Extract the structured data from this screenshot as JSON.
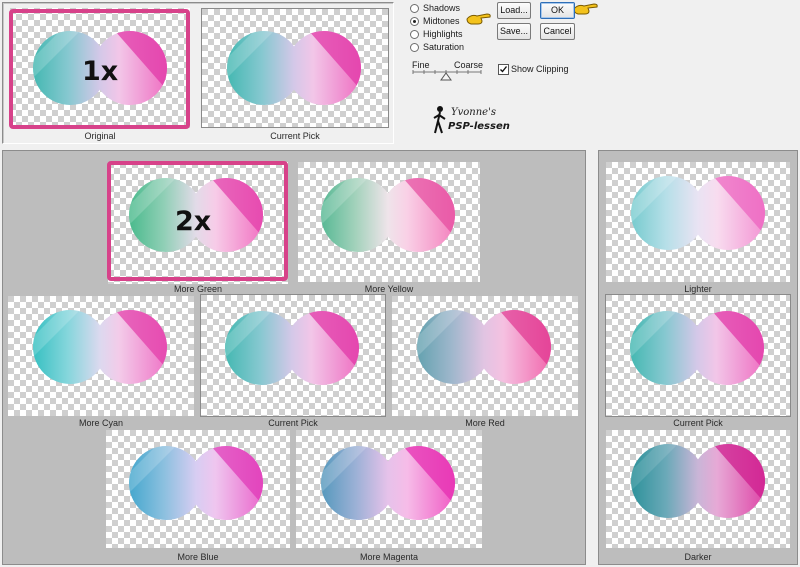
{
  "tones": {
    "options": [
      {
        "label": "Shadows",
        "selected": false
      },
      {
        "label": "Midtones",
        "selected": true
      },
      {
        "label": "Highlights",
        "selected": false
      },
      {
        "label": "Saturation",
        "selected": false
      }
    ]
  },
  "buttons": {
    "load": "Load...",
    "ok": "OK",
    "save": "Save...",
    "cancel": "Cancel"
  },
  "slider": {
    "fine_label": "Fine",
    "coarse_label": "Coarse"
  },
  "show_clipping": {
    "label": "Show Clipping",
    "checked": true
  },
  "watermark": {
    "line1": "Yvonne's",
    "line2": "PSP-lessen"
  },
  "top": {
    "original_label": "Original",
    "current_pick_label": "Current Pick"
  },
  "annotations": {
    "step1": "1x",
    "step2": "2x"
  },
  "variations": {
    "more_green": "More Green",
    "more_yellow": "More Yellow",
    "more_cyan": "More Cyan",
    "current_pick": "Current Pick",
    "more_red": "More Red",
    "more_blue": "More Blue",
    "more_magenta": "More Magenta"
  },
  "brightness": {
    "lighter": "Lighter",
    "current_pick": "Current Pick",
    "darker": "Darker"
  },
  "colors": {
    "accent": "#d7428a",
    "selected_border": "#2f6fb7",
    "pointer": "#f3c21c"
  }
}
